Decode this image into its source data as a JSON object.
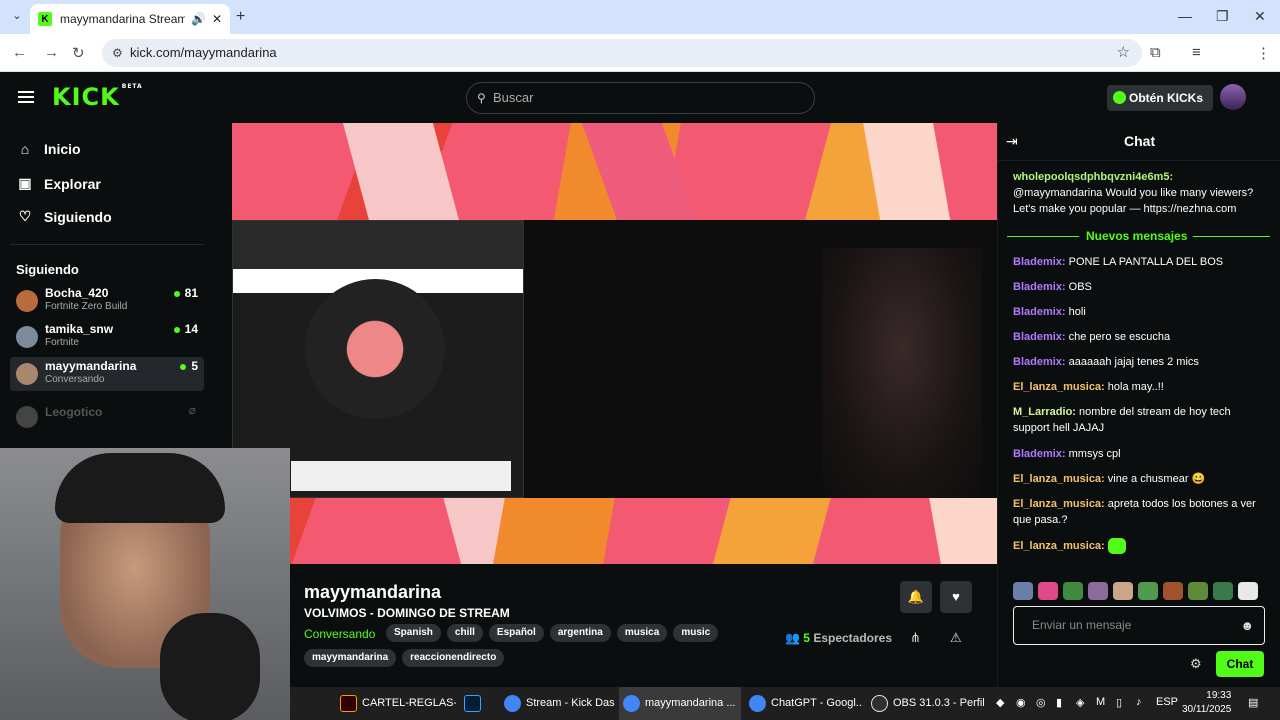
{
  "browser": {
    "tab_title": "mayymandarina Stream - W",
    "url": "kick.com/mayymandarina"
  },
  "header": {
    "logo": "KICK",
    "logo_badge": "BETA",
    "search_placeholder": "Buscar",
    "kicks_button": "Obtén KICKs"
  },
  "sidebar": {
    "nav": [
      {
        "label": "Inicio",
        "icon": "home-icon"
      },
      {
        "label": "Explorar",
        "icon": "compass-icon"
      },
      {
        "label": "Siguiendo",
        "icon": "heart-icon"
      }
    ],
    "following_heading": "Siguiendo",
    "following": [
      {
        "name": "Bocha_420",
        "game": "Fortnite Zero Build",
        "viewers": "81"
      },
      {
        "name": "tamika_snw",
        "game": "Fortnite",
        "viewers": "14"
      },
      {
        "name": "mayymandarina",
        "game": "Conversando",
        "viewers": "5"
      },
      {
        "name": "Leogotico",
        "game": "",
        "viewers": ""
      }
    ]
  },
  "stream": {
    "streamer": "mayymandarina",
    "title": "VOLVIMOS - DOMINGO DE STREAM",
    "category": "Conversando",
    "tags": [
      "Spanish",
      "chill",
      "Español",
      "argentina",
      "musica",
      "music"
    ],
    "tags_row2": [
      "mayymandarina",
      "reaccionendirecto"
    ],
    "viewers_count": "5",
    "viewers_label": "Espectadores"
  },
  "chat": {
    "title": "Chat",
    "new_messages": "Nuevos mensajes",
    "messages": [
      {
        "user": "wholepoolqsdphbqvzni4e6m5:",
        "text": "@mayymandarina Would you like many viewers? Let's make you popular — https://nezhna.com",
        "color": "#b2f47a"
      },
      {
        "user": "Blademix:",
        "text": "PONE LA PANTALLA DEL BOS",
        "color": "#b278ff"
      },
      {
        "user": "Blademix:",
        "text": "OBS",
        "color": "#b278ff"
      },
      {
        "user": "Blademix:",
        "text": "holi",
        "color": "#b278ff"
      },
      {
        "user": "Blademix:",
        "text": "che pero se escucha",
        "color": "#b278ff"
      },
      {
        "user": "Blademix:",
        "text": "aaaaaah jajaj tenes 2 mics",
        "color": "#b278ff"
      },
      {
        "user": "El_lanza_musica:",
        "text": "hola may..!!",
        "color": "#f5c26b"
      },
      {
        "user": "M_Larradio:",
        "text": "nombre del stream de hoy tech support hell JAJAJ",
        "color": "#d8f59a"
      },
      {
        "user": "Blademix:",
        "text": "mmsys cpl",
        "color": "#b278ff"
      },
      {
        "user": "El_lanza_musica:",
        "text": "vine a chusmear 😀",
        "color": "#f5c26b"
      },
      {
        "user": "El_lanza_musica:",
        "text": "apreta todos los botones a ver que pasa.?",
        "color": "#f5c26b"
      },
      {
        "user": "El_lanza_musica:",
        "text": "",
        "color": "#f5c26b"
      }
    ],
    "input_placeholder": "Enviar un mensaje",
    "send_button": "Chat"
  },
  "taskbar": {
    "items": [
      "CARTEL-REGLAS-...",
      "",
      "Stream - Kick Das...",
      "mayymandarina ...",
      "ChatGPT - Googl...",
      "OBS 31.0.3 - Perfil..."
    ],
    "language": "ESP",
    "time": "19:33",
    "date": "30/11/2025"
  },
  "colors": {
    "kick_green": "#53fc18",
    "background": "#0b0e0f",
    "tag_bg": "#2d3235"
  }
}
